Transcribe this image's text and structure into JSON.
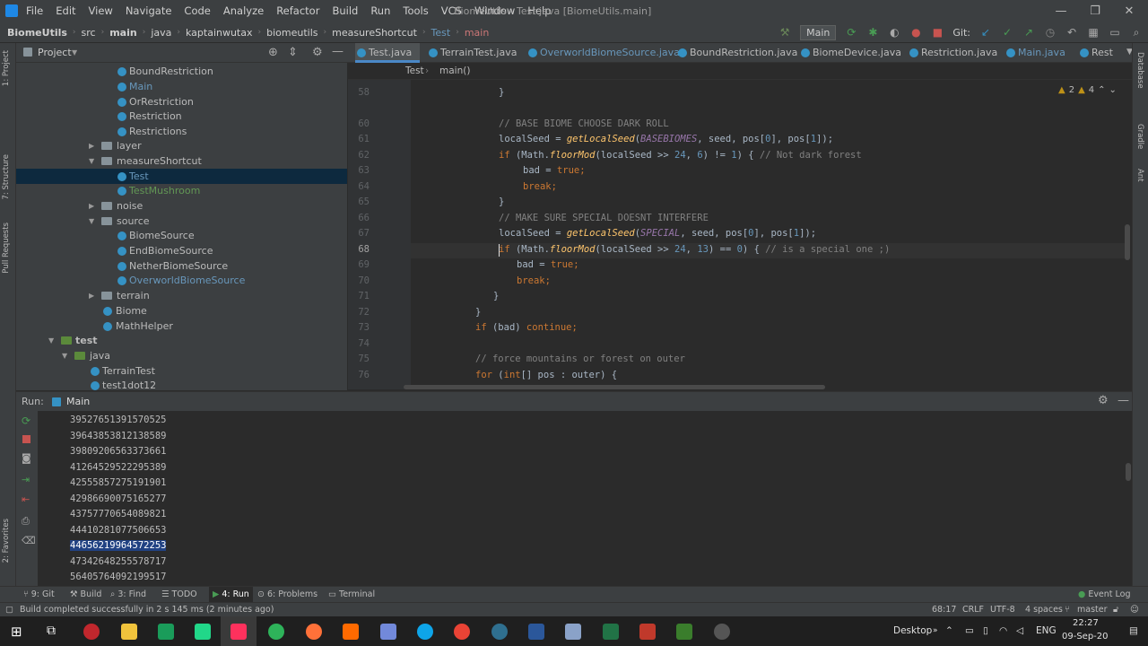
{
  "window": {
    "title": "BiomeUtils - Test.java [BiomeUtils.main]",
    "menus": [
      "File",
      "Edit",
      "View",
      "Navigate",
      "Code",
      "Analyze",
      "Refactor",
      "Build",
      "Run",
      "Tools",
      "VCS",
      "Window",
      "Help"
    ],
    "minimize": "—",
    "maximize": "❐",
    "close": "✕"
  },
  "navbar": {
    "breadcrumbs": [
      "BiomeUtils",
      "src",
      "main",
      "java",
      "kaptainwutax",
      "biomeutils",
      "measureShortcut",
      "Test",
      "main"
    ],
    "run_config": "Main",
    "git_label": "Git:"
  },
  "project": {
    "header": "Project",
    "tree": [
      {
        "label": "BoundRestriction",
        "kind": "class"
      },
      {
        "label": "Main",
        "kind": "class",
        "style": "blue"
      },
      {
        "label": "OrRestriction",
        "kind": "class"
      },
      {
        "label": "Restriction",
        "kind": "class"
      },
      {
        "label": "Restrictions",
        "kind": "class"
      },
      {
        "label": "layer",
        "kind": "folder"
      },
      {
        "label": "measureShortcut",
        "kind": "folder"
      },
      {
        "label": "Test",
        "kind": "class",
        "style": "blue",
        "selected": true
      },
      {
        "label": "TestMushroom",
        "kind": "class",
        "style": "dim"
      },
      {
        "label": "noise",
        "kind": "folder"
      },
      {
        "label": "source",
        "kind": "folder"
      },
      {
        "label": "BiomeSource",
        "kind": "class"
      },
      {
        "label": "EndBiomeSource",
        "kind": "class"
      },
      {
        "label": "NetherBiomeSource",
        "kind": "class"
      },
      {
        "label": "OverworldBiomeSource",
        "kind": "class",
        "style": "blue"
      },
      {
        "label": "terrain",
        "kind": "folder"
      },
      {
        "label": "Biome",
        "kind": "class"
      },
      {
        "label": "MathHelper",
        "kind": "class"
      },
      {
        "label": "test",
        "kind": "folder-src"
      },
      {
        "label": "java",
        "kind": "folder-src"
      },
      {
        "label": "TerrainTest",
        "kind": "class"
      },
      {
        "label": "test1dot12",
        "kind": "class"
      }
    ]
  },
  "editor": {
    "tabs": [
      "Test.java",
      "TerrainTest.java",
      "OverworldBiomeSource.java",
      "BoundRestriction.java",
      "BiomeDevice.java",
      "Restriction.java",
      "Main.java",
      "Rest"
    ],
    "breadcrumb": [
      "Test",
      "main()"
    ],
    "inspections": {
      "warnings": "2",
      "weak": "4"
    },
    "lines": [
      {
        "n": "58"
      },
      {
        "n": "60"
      },
      {
        "n": "61"
      },
      {
        "n": "62"
      },
      {
        "n": "63"
      },
      {
        "n": "64"
      },
      {
        "n": "65"
      },
      {
        "n": "66"
      },
      {
        "n": "67"
      },
      {
        "n": "68"
      },
      {
        "n": "69"
      },
      {
        "n": "70"
      },
      {
        "n": "71"
      },
      {
        "n": "72"
      },
      {
        "n": "73"
      },
      {
        "n": "74"
      },
      {
        "n": "75"
      },
      {
        "n": "76"
      }
    ],
    "code": {
      "l58": "}",
      "l60_comment": "// BASE BIOME CHOOSE DARK ROLL",
      "l61_a": "localSeed = ",
      "l61_fn": "getLocalSeed",
      "l61_b": "(",
      "l61_c": "BASEBIOMES",
      "l61_d": ", seed, pos[",
      "l61_e": "0",
      "l61_f": "], pos[",
      "l61_g": "1",
      "l61_h": "]);",
      "l62_kw": "if",
      "l62_a": " (Math.",
      "l62_fn": "floorMod",
      "l62_b": "(localSeed >> ",
      "l62_n1": "24",
      "l62_c": ", ",
      "l62_n2": "6",
      "l62_d": ") != ",
      "l62_n3": "1",
      "l62_e": ") { ",
      "l62_cm": "// Not dark forest",
      "l63_a": "bad = ",
      "l63_kw": "true",
      "l63_b": ";",
      "l64_kw": "break",
      "l64_b": ";",
      "l65": "}",
      "l66_comment": "// MAKE SURE SPECIAL DOESNT INTERFERE",
      "l67_a": "localSeed = ",
      "l67_fn": "getLocalSeed",
      "l67_b": "(",
      "l67_c": "SPECIAL",
      "l67_d": ", seed, pos[",
      "l67_e": "0",
      "l67_f": "], pos[",
      "l67_g": "1",
      "l67_h": "]);",
      "l68_kw": "if",
      "l68_a": " (Math.",
      "l68_fn": "floorMod",
      "l68_b": "(localSeed >> ",
      "l68_n1": "24",
      "l68_c": ", ",
      "l68_n2": "13",
      "l68_d": ") == ",
      "l68_n3": "0",
      "l68_e": ") { ",
      "l68_cm": "// is a special one ;)",
      "l69_a": "bad = ",
      "l69_kw": "true",
      "l69_b": ";",
      "l70_kw": "break",
      "l70_b": ";",
      "l71": "}",
      "l72": "}",
      "l73_kw": "if",
      "l73_a": " (bad) ",
      "l73_kw2": "continue",
      "l73_b": ";",
      "l75_comment": "// force mountains or forest on outer",
      "l76_kw": "for",
      "l76_a": " (",
      "l76_kw2": "int",
      "l76_b": "[] pos : outer) {"
    }
  },
  "run": {
    "label": "Run:",
    "config": "Main",
    "output": [
      "39527651391570525",
      "39643853812138589",
      "39809206563373661",
      "41264529522295389",
      "42555857275191901",
      "42986690075165277",
      "43757770654089821",
      "44410281077506653",
      "44656219964572253",
      "47342648255578717",
      "56405764092199517"
    ],
    "highlighted_index": 8
  },
  "bottom_tools": [
    "9: Git",
    "Build",
    "3: Find",
    "TODO",
    "4: Run",
    "6: Problems",
    "Terminal",
    "Event Log"
  ],
  "status": {
    "message": "Build completed successfully in 2 s 145 ms (2 minutes ago)",
    "position": "68:17",
    "line_sep": "CRLF",
    "encoding": "UTF-8",
    "indent": "4 spaces",
    "branch": "master"
  },
  "left_stripe": [
    "1: Project",
    "7: Structure",
    "Pull Requests",
    "2: Favorites"
  ],
  "right_stripe": [
    "Database",
    "Gradle",
    "Ant"
  ],
  "taskbar": {
    "desktop_label": "Desktop",
    "lang": "ENG",
    "time": "22:27",
    "date": "09-Sep-20"
  }
}
